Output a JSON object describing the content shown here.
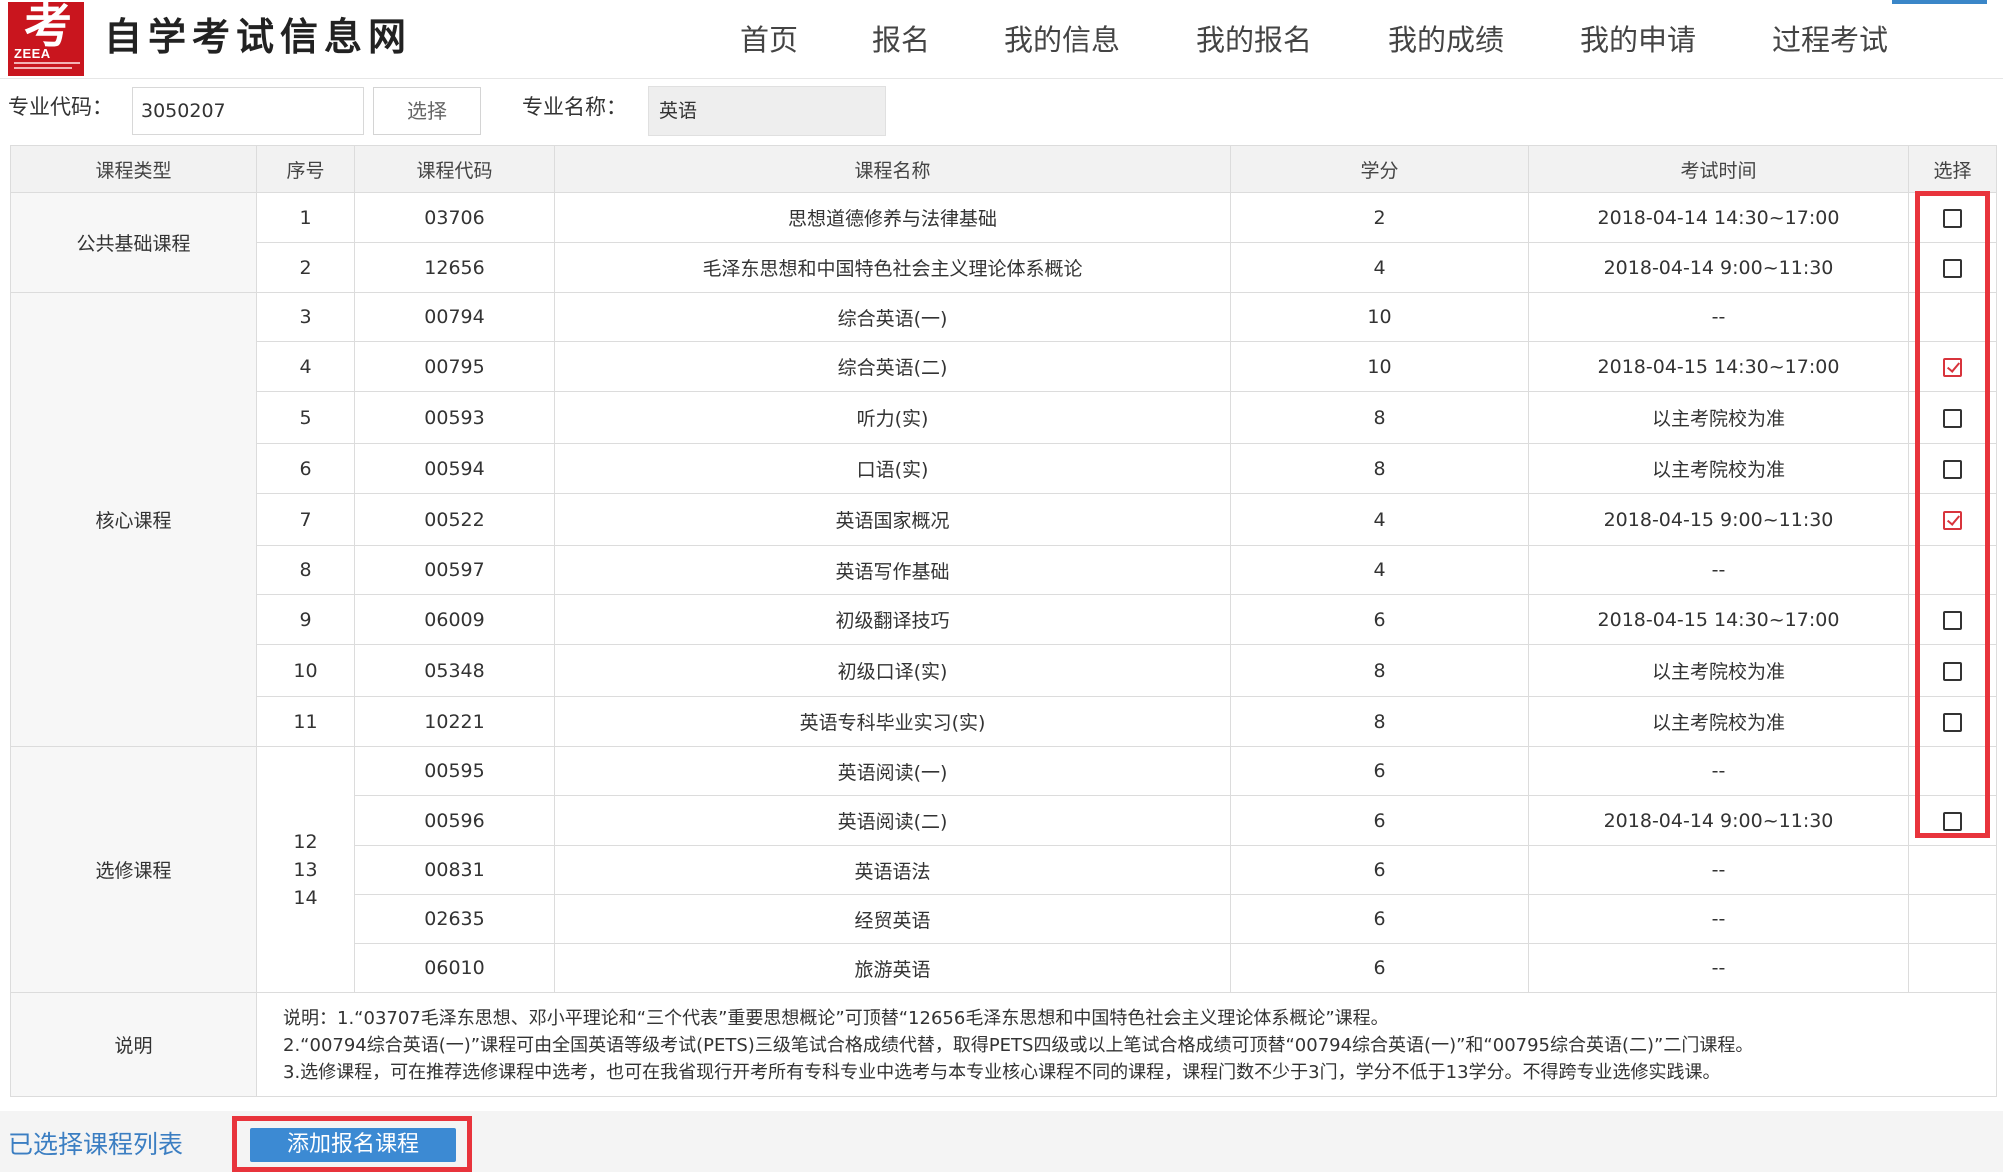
{
  "header": {
    "logo_glyph": "考",
    "logo_text": "ZEEA",
    "site_title": "自学考试信息网",
    "nav": [
      {
        "label": "首页"
      },
      {
        "label": "报名"
      },
      {
        "label": "我的信息"
      },
      {
        "label": "我的报名"
      },
      {
        "label": "我的成绩"
      },
      {
        "label": "我的申请"
      },
      {
        "label": "过程考试"
      }
    ]
  },
  "form": {
    "major_code_label": "专业代码：",
    "major_code_value": "3050207",
    "select_button": "选择",
    "major_name_label": "专业名称：",
    "major_name_value": "英语"
  },
  "table": {
    "columns": [
      "课程类型",
      "序号",
      "课程代码",
      "课程名称",
      "学分",
      "考试时间",
      "选择"
    ],
    "groups": [
      {
        "type": "公共基础课程"
      },
      {
        "type": "核心课程"
      },
      {
        "type": "选修课程",
        "seq_stack": [
          "12",
          "13",
          "14"
        ]
      }
    ],
    "rows": [
      {
        "seq": "1",
        "code": "03706",
        "name": "思想道德修养与法律基础",
        "credit": "2",
        "time": "2018-04-14 14:30~17:00",
        "checkbox": true,
        "checked": false
      },
      {
        "seq": "2",
        "code": "12656",
        "name": "毛泽东思想和中国特色社会主义理论体系概论",
        "credit": "4",
        "time": "2018-04-14 9:00~11:30",
        "checkbox": true,
        "checked": false
      },
      {
        "seq": "3",
        "code": "00794",
        "name": "综合英语(一)",
        "credit": "10",
        "time": "--",
        "checkbox": false,
        "checked": false
      },
      {
        "seq": "4",
        "code": "00795",
        "name": "综合英语(二)",
        "credit": "10",
        "time": "2018-04-15 14:30~17:00",
        "checkbox": true,
        "checked": true
      },
      {
        "seq": "5",
        "code": "00593",
        "name": "听力(实)",
        "credit": "8",
        "time": "以主考院校为准",
        "checkbox": true,
        "checked": false
      },
      {
        "seq": "6",
        "code": "00594",
        "name": "口语(实)",
        "credit": "8",
        "time": "以主考院校为准",
        "checkbox": true,
        "checked": false
      },
      {
        "seq": "7",
        "code": "00522",
        "name": "英语国家概况",
        "credit": "4",
        "time": "2018-04-15 9:00~11:30",
        "checkbox": true,
        "checked": true
      },
      {
        "seq": "8",
        "code": "00597",
        "name": "英语写作基础",
        "credit": "4",
        "time": "--",
        "checkbox": false,
        "checked": false
      },
      {
        "seq": "9",
        "code": "06009",
        "name": "初级翻译技巧",
        "credit": "6",
        "time": "2018-04-15 14:30~17:00",
        "checkbox": true,
        "checked": false
      },
      {
        "seq": "10",
        "code": "05348",
        "name": "初级口译(实)",
        "credit": "8",
        "time": "以主考院校为准",
        "checkbox": true,
        "checked": false
      },
      {
        "seq": "11",
        "code": "10221",
        "name": "英语专科毕业实习(实)",
        "credit": "8",
        "time": "以主考院校为准",
        "checkbox": true,
        "checked": false
      },
      {
        "seq": "",
        "code": "00595",
        "name": "英语阅读(一)",
        "credit": "6",
        "time": "--",
        "checkbox": false,
        "checked": false
      },
      {
        "seq": "",
        "code": "00596",
        "name": "英语阅读(二)",
        "credit": "6",
        "time": "2018-04-14 9:00~11:30",
        "checkbox": true,
        "checked": false
      },
      {
        "seq": "",
        "code": "00831",
        "name": "英语语法",
        "credit": "6",
        "time": "--",
        "checkbox": false,
        "checked": false
      },
      {
        "seq": "",
        "code": "02635",
        "name": "经贸英语",
        "credit": "6",
        "time": "--",
        "checkbox": false,
        "checked": false
      },
      {
        "seq": "",
        "code": "06010",
        "name": "旅游英语",
        "credit": "6",
        "time": "--",
        "checkbox": false,
        "checked": false
      }
    ],
    "notes_label": "说明",
    "notes": [
      "说明：1.“03707毛泽东思想、邓小平理论和“三个代表”重要思想概论”可顶替“12656毛泽东思想和中国特色社会主义理论体系概论”课程。",
      "2.“00794综合英语(一)”课程可由全国英语等级考试(PETS)三级笔试合格成绩代替，取得PETS四级或以上笔试合格成绩可顶替“00794综合英语(一)”和“00795综合英语(二)”二门课程。",
      "3.选修课程，可在推荐选修课程中选考，也可在我省现行开考所有专科专业中选考与本专业核心课程不同的课程，课程门数不少于3门，学分不低于13学分。不得跨专业选修实践课。"
    ]
  },
  "bottom": {
    "selected_list_link": "已选择课程列表",
    "add_button": "添加报名课程"
  },
  "colors": {
    "accent_blue": "#3c8ad3",
    "link_blue": "#3b7ec2",
    "highlight_red": "#e8343c",
    "logo_red": "#c9151e"
  }
}
